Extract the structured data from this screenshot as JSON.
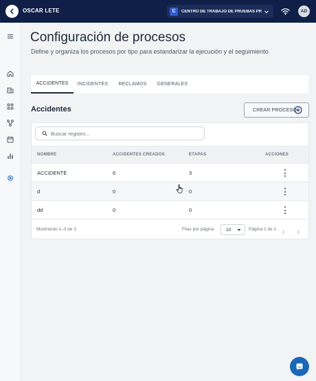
{
  "topbar": {
    "user_name": "OSCAR LETE",
    "center_badge": "C",
    "center_name": "CENTRO DE TRABAJO DE PRUEBAS PRIN...",
    "avatar_initials": "AD",
    "bg_color": "#0f1f48"
  },
  "sidebar": {
    "icons": [
      "menu-icon",
      "home-icon",
      "building-icon",
      "grid-icon",
      "flow-icon",
      "calendar-icon",
      "bar-chart-icon",
      "settings-icon"
    ],
    "active": "settings-icon",
    "accent_color": "#1b67b6"
  },
  "page": {
    "title": "Configuración de procesos",
    "subtitle": "Define y organiza los procesos por tipo para estandarizar la ejecución y el seguimiento"
  },
  "tabs": [
    {
      "label": "ACCIDENTES",
      "active": true
    },
    {
      "label": "INCIDENTES",
      "active": false
    },
    {
      "label": "RECLAMOS",
      "active": false
    },
    {
      "label": "GENERALES",
      "active": false
    }
  ],
  "section": {
    "title": "Accidentes",
    "create_label": "CREAR PROCESO"
  },
  "search": {
    "placeholder": "Buscar registro..."
  },
  "table": {
    "headers": [
      "NOMBRE",
      "ACCIDENTES CREADOS",
      "ETAPAS",
      "ACCIONES"
    ],
    "rows": [
      [
        "ACCIDENTE",
        "6",
        "3"
      ],
      [
        "d",
        "0",
        "0"
      ],
      [
        "dd",
        "0",
        "0"
      ]
    ]
  },
  "pagination": {
    "showing": "Mostrando 1–3 de 3",
    "rows_label": "Filas por página",
    "rows_value": "10",
    "page_label": "Página 1 de 1"
  }
}
